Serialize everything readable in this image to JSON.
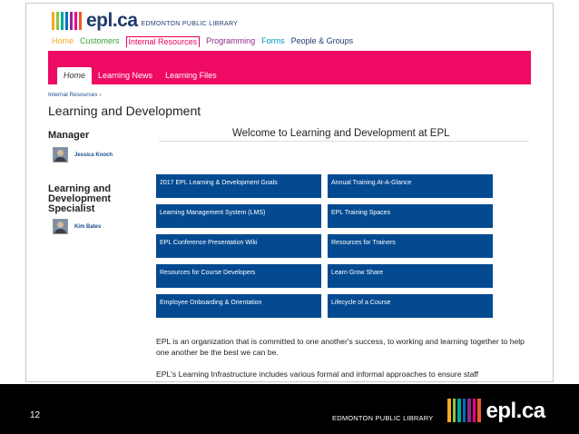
{
  "header": {
    "logo_text": "epl.ca",
    "logo_subtitle": "EDMONTON PUBLIC LIBRARY",
    "logo_bar_colors": [
      "#f7a823",
      "#8dc63f",
      "#00a99d",
      "#0071bc",
      "#93278f",
      "#ec008c",
      "#f15a24"
    ]
  },
  "top_nav": [
    {
      "label": "Home",
      "color": "#f7a823"
    },
    {
      "label": "Customers",
      "color": "#3aa335"
    },
    {
      "label": "Internal Resources",
      "color": "#e8005b"
    },
    {
      "label": "Programming",
      "color": "#93278f"
    },
    {
      "label": "Forms",
      "color": "#0094c8"
    },
    {
      "label": "People & Groups",
      "color": "#1f3b6e"
    }
  ],
  "tabs": [
    "Home",
    "Learning News",
    "Learning Files"
  ],
  "breadcrumb": "Internal Resources ›",
  "page_title": "Learning and Development",
  "manager": {
    "heading": "Manager",
    "name": "Jessica Knoch"
  },
  "specialist": {
    "heading": "Learning and Development Specialist",
    "name": "Kim Bates"
  },
  "welcome": "Welcome to Learning and Development at EPL",
  "tiles": [
    "2017 EPL Learning & Development Goals",
    "Annual Training At-A-Glance",
    "Learning Management System (LMS)",
    "EPL Training Spaces",
    "EPL Conference Presentation Wiki",
    "Resources for Trainers",
    "Resources for Course Developers",
    "Learn Grow Share",
    "Employee Onboarding & Orientation",
    "Lifecycle of a Course"
  ],
  "paragraph1": "EPL is an organization that is committed to one another's success, to working and learning together to help one another be the best we can be.",
  "paragraph2": "EPL's Learning Infrastructure includes various formal and informal approaches to ensure staff",
  "footer": {
    "slide_number": "12",
    "library_name": "EDMONTON PUBLIC LIBRARY",
    "logo_text": "epl.ca"
  }
}
